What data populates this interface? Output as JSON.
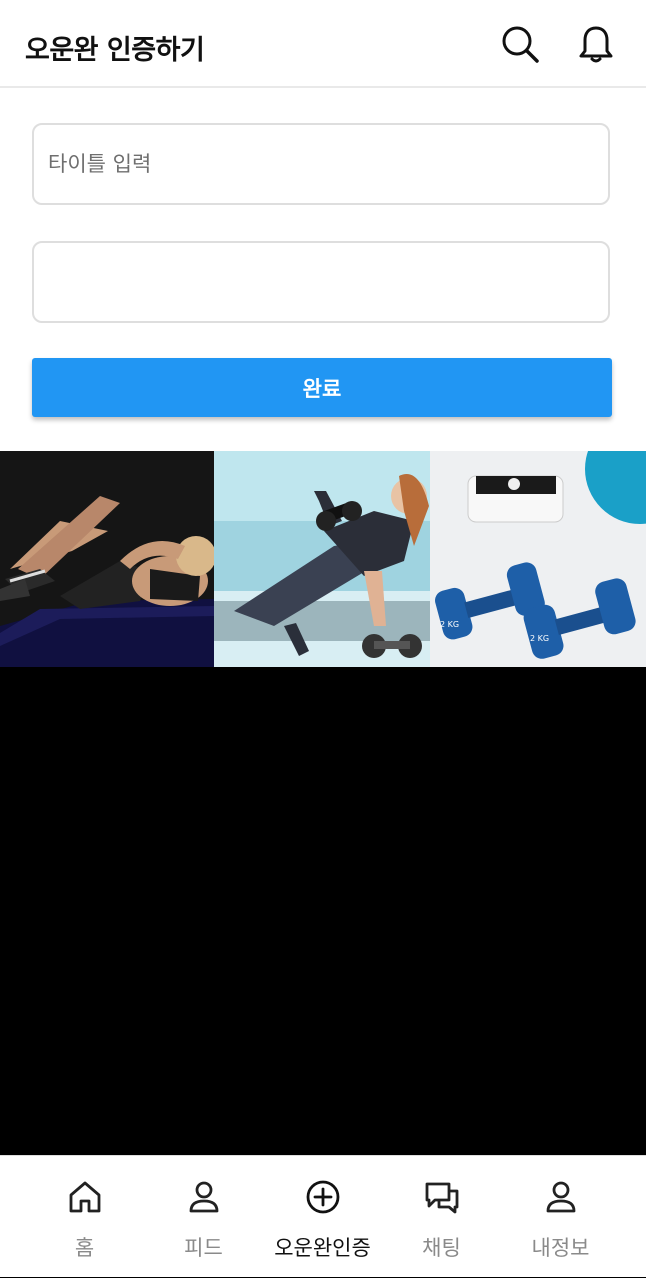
{
  "header": {
    "title": "오운완 인증하기",
    "icons": [
      "search-icon",
      "bell-icon"
    ]
  },
  "form": {
    "title_placeholder": "타이틀 입력",
    "title_value": "",
    "body_value": "",
    "submit_label": "완료"
  },
  "photos": [
    {
      "subject": "woman-doing-crunches-on-mat"
    },
    {
      "subject": "woman-lifting-dumbbell-in-gym"
    },
    {
      "subject": "blue-dumbbells-and-scale"
    }
  ],
  "photo_text": {
    "dumbbell_weight": "2 KG"
  },
  "tabs": [
    {
      "label": "홈",
      "icon": "home-icon",
      "active": false
    },
    {
      "label": "피드",
      "icon": "person-icon",
      "active": false
    },
    {
      "label": "오운완인증",
      "icon": "plus-circle-icon",
      "active": true
    },
    {
      "label": "채팅",
      "icon": "chat-icon",
      "active": false
    },
    {
      "label": "내정보",
      "icon": "person-icon",
      "active": false
    }
  ],
  "colors": {
    "accent": "#2196f3",
    "tab_inactive": "#8a8a8a",
    "tab_active": "#111111"
  }
}
